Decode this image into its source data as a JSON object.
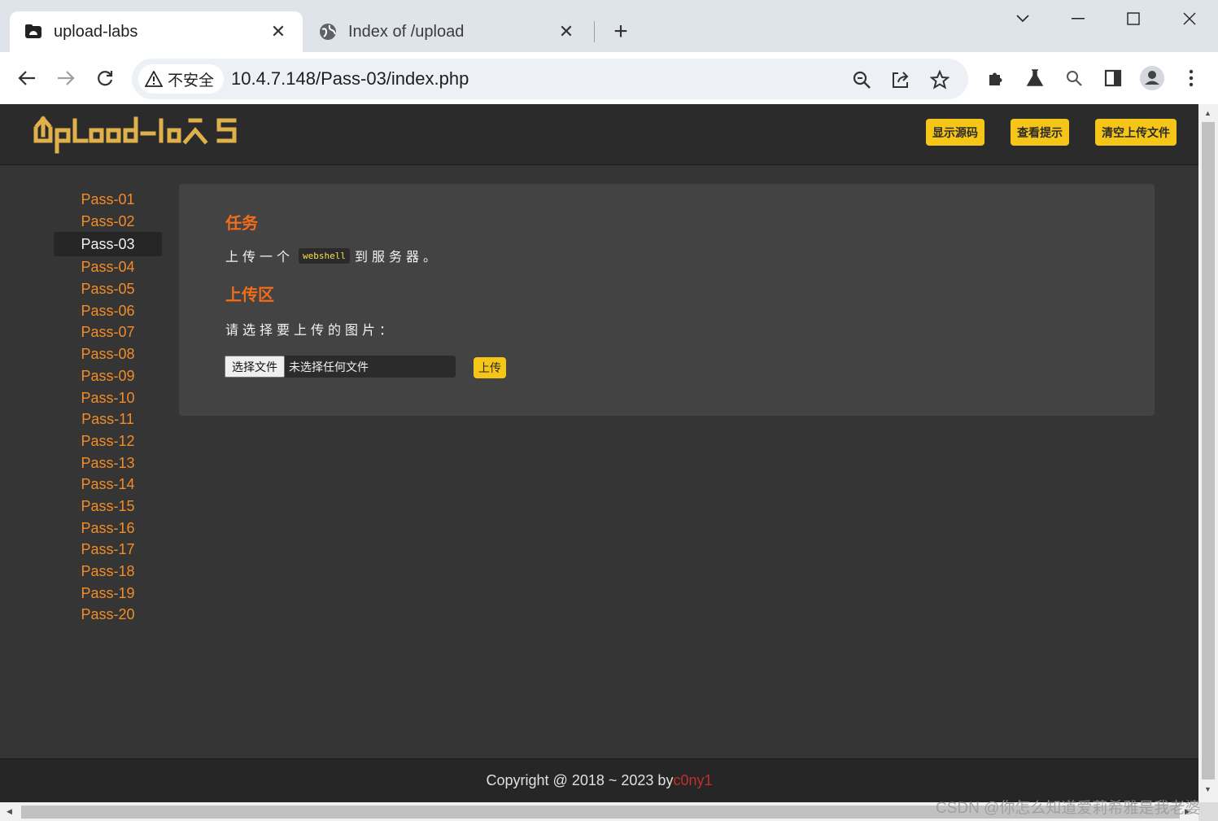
{
  "browser": {
    "tabs": [
      {
        "title": "upload-labs",
        "icon": "folder-icon",
        "active": true
      },
      {
        "title": "Index of /upload",
        "icon": "globe-icon",
        "active": false
      }
    ],
    "security_label": "不安全",
    "url": "10.4.7.148/Pass-03/index.php"
  },
  "header": {
    "logo_text": "UpLoad-labs",
    "buttons": [
      "显示源码",
      "查看提示",
      "清空上传文件"
    ]
  },
  "sidebar": {
    "active": "Pass-03",
    "items": [
      "Pass-01",
      "Pass-02",
      "Pass-03",
      "Pass-04",
      "Pass-05",
      "Pass-06",
      "Pass-07",
      "Pass-08",
      "Pass-09",
      "Pass-10",
      "Pass-11",
      "Pass-12",
      "Pass-13",
      "Pass-14",
      "Pass-15",
      "Pass-16",
      "Pass-17",
      "Pass-18",
      "Pass-19",
      "Pass-20"
    ]
  },
  "main": {
    "task_heading": "任务",
    "task_prefix": "上传一个",
    "task_code": "webshell",
    "task_suffix": "到服务器。",
    "upload_heading": "上传区",
    "choose_label": "请选择要上传的图片：",
    "file_button": "选择文件",
    "file_status": "未选择任何文件",
    "submit_label": "上传"
  },
  "footer": {
    "text": "Copyright @ 2018 ~ 2023 by ",
    "author": "c0ny1"
  },
  "watermark": "CSDN @你怎么知道爱莉希雅是我老婆",
  "colors": {
    "accent": "#f5c518",
    "heading": "#f26c1a",
    "link": "#f28c28",
    "author": "#c0302b",
    "page_bg": "#353535"
  }
}
